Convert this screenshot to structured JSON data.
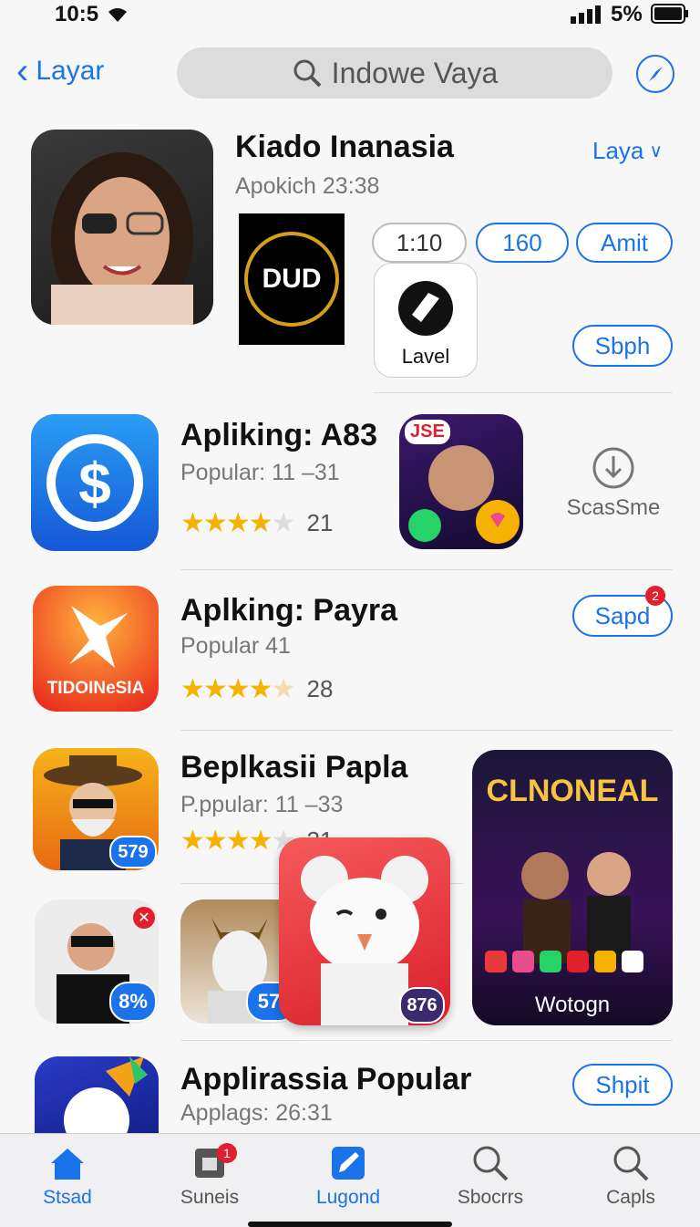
{
  "status": {
    "time": "10:5",
    "battery": "5%"
  },
  "nav": {
    "back_label": "Layar",
    "search_text": "Indowe Vaya"
  },
  "featured": {
    "title": "Kiado Inanasia",
    "subtitle": "Apokich 23:38",
    "dropdown": "Laya",
    "chips": [
      "1:10",
      "160",
      "Amit"
    ],
    "logo_text": "DUD",
    "mini_app_label": "Lavel",
    "action": "Sbph"
  },
  "rows": [
    {
      "title": "Apliking: A83",
      "subtitle": "Popular: 11 –31",
      "rating": "21",
      "side_badge": "JSE",
      "action": "ScasSme"
    },
    {
      "title": "Aplking: Payra",
      "subtitle": "Popular 41",
      "rating": "28",
      "icon_text": "TIDOINeSIA",
      "action": "Sapd",
      "action_badge": "2"
    },
    {
      "title": "Beplkasii Papla",
      "subtitle": "P.ppular: 11 –33",
      "rating": "21",
      "icon_badge": "579"
    },
    {
      "title": "Applirassia Popular",
      "subtitle": "Applags: 26:31",
      "action": "Shpit"
    }
  ],
  "tiles": {
    "tile1_badge": "8%",
    "tile2_badge": "57.",
    "tile3_badge": "876",
    "game_title": "CLNONEAL",
    "game_label": "Wotogn"
  },
  "tabs": [
    {
      "label": "Stsad",
      "icon": "home-icon"
    },
    {
      "label": "Suneis",
      "icon": "store-icon",
      "badge": "1"
    },
    {
      "label": "Lugond",
      "icon": "pencil-icon"
    },
    {
      "label": "Sbocrrs",
      "icon": "search-icon"
    },
    {
      "label": "Capls",
      "icon": "search-icon"
    }
  ],
  "colors": {
    "accent": "#1a73e8",
    "star": "#f5b200",
    "badge": "#e0202c"
  }
}
